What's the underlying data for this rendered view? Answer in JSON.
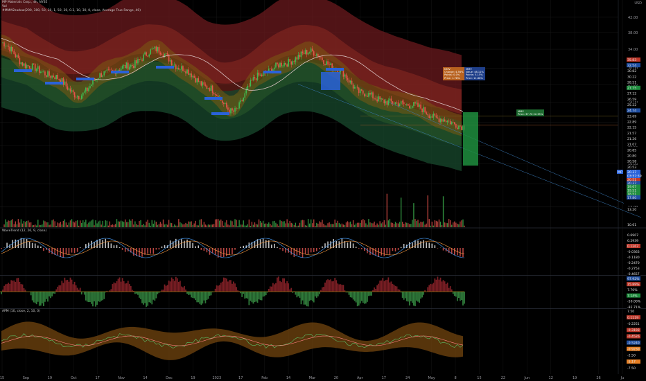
{
  "header": {
    "symbol_line": "MP Materials Corp., 4h, NYSE",
    "vol_line": "Vol",
    "indicator_line": "#MMAShadow(200, 300, 50, 30, 1, 50, 30, 0.3, 10, 30, 0, close, Average True Range, 40)",
    "currency": "USD"
  },
  "panes": {
    "pane2_title": "WaveTrend (12, 26, 9, close)",
    "pane4_title": "APM (10, close, 2, 10, 0)"
  },
  "info_boxes": {
    "orange": {
      "title": "MMV",
      "lines": [
        "Change: 4.56%",
        "Points: 0.0%",
        "Price: 1.78%"
      ]
    },
    "blue": {
      "title": "MMV",
      "lines": [
        "Value: 48.11%",
        "Points: 5.15%",
        "Price: 11.88%"
      ]
    },
    "green": {
      "title": "MMV",
      "lines": [
        "Price: 37.70 22.35%"
      ]
    }
  },
  "chart_data": {
    "type": "line",
    "symbol": "MP",
    "timeframe": "4h",
    "x_tick_labels": [
      "15",
      "Sep",
      "19",
      "Oct",
      "17",
      "Nov",
      "14",
      "Dec",
      "19",
      "2023",
      "17",
      "Feb",
      "14",
      "Mar",
      "20",
      "Apr",
      "17",
      "24",
      "May",
      "8",
      "15",
      "22",
      "Jun",
      "12",
      "19",
      "26",
      "Ju"
    ],
    "price_axis_ticks": [
      42.0,
      38.0,
      34.0,
      30.0,
      27.0,
      24.0,
      21.0,
      18.0,
      16.0,
      14.0,
      12.0
    ],
    "price_scale": "log",
    "price_labels": [
      {
        "value": "35.83",
        "color": "#c0392b"
      },
      {
        "value": "32.54",
        "color": "#1f4fa3"
      },
      {
        "value": "30.82",
        "color": "#000000"
      },
      {
        "value": "30.22",
        "color": "#000000"
      },
      {
        "value": "28.51",
        "color": "#000000"
      },
      {
        "value": "27.75",
        "color": "#1e8e3e"
      },
      {
        "value": "27.12",
        "color": "#000000"
      },
      {
        "value": "26.59",
        "color": "#000000"
      },
      {
        "value": "25.22",
        "color": "#000000"
      },
      {
        "value": "24.74",
        "color": "#1f4fa3"
      },
      {
        "value": "23.69",
        "color": "#000000"
      },
      {
        "value": "22.89",
        "color": "#000000"
      },
      {
        "value": "22.15",
        "color": "#000000"
      },
      {
        "value": "21.57",
        "color": "#000000"
      },
      {
        "value": "21.26",
        "color": "#000000"
      },
      {
        "value": "21.07",
        "color": "#000000"
      },
      {
        "value": "20.85",
        "color": "#000000"
      },
      {
        "value": "20.80",
        "color": "#000000"
      },
      {
        "value": "20.58",
        "color": "#000000"
      },
      {
        "value": "20.53",
        "color": "#000000"
      },
      {
        "value": "20.51",
        "color": "#c0392b"
      },
      {
        "value": "20.37",
        "color": "#1f4fa3"
      },
      {
        "value": "19.67",
        "color": "#1e8e3e"
      },
      {
        "value": "19.51",
        "color": "#1e8e3e"
      },
      {
        "value": "18.51",
        "color": "#1e8e3e"
      },
      {
        "value": "17.80",
        "color": "#1f4fa3"
      },
      {
        "value": "13.20",
        "color": "#000000"
      },
      {
        "value": "10.61",
        "color": "#000000"
      }
    ],
    "last_price": {
      "symbol": "MP",
      "value": "20.37",
      "countdown": "03:57:39"
    },
    "price_approx": {
      "x": [
        "15",
        "Sep",
        "19",
        "Oct",
        "17",
        "Nov",
        "14",
        "Dec",
        "19",
        "2023",
        "17",
        "Feb",
        "14",
        "Mar",
        "20",
        "Apr",
        "17",
        "24",
        "May"
      ],
      "close": [
        35.5,
        30.5,
        28.5,
        25.0,
        29.0,
        30.5,
        34.0,
        30.0,
        26.5,
        22.5,
        28.5,
        31.0,
        33.5,
        30.0,
        25.5,
        24.0,
        23.5,
        21.5,
        20.4
      ]
    },
    "pane2_labels": [
      {
        "value": "0.6907",
        "color": "#000000"
      },
      {
        "value": "0.2939",
        "color": "#000000"
      },
      {
        "value": "0.1267",
        "color": "#c0392b"
      },
      {
        "value": "-0.0363",
        "color": "#000000"
      },
      {
        "value": "-0.1180",
        "color": "#000000"
      },
      {
        "value": "-0.2470",
        "color": "#000000"
      },
      {
        "value": "-0.2753",
        "color": "#000000"
      },
      {
        "value": "-0.4657",
        "color": "#000000"
      }
    ],
    "pane3_labels": [
      {
        "value": "97.92%",
        "color": "#1f4fa3"
      },
      {
        "value": "15.89%",
        "color": "#c0392b"
      },
      {
        "value": "7.70%",
        "color": "#000000"
      },
      {
        "value": "7.14%",
        "color": "#1e8e3e"
      },
      {
        "value": "-50.00%",
        "color": "#000000"
      },
      {
        "value": "-82.71%",
        "color": "#000000"
      }
    ],
    "pane4_labels": [
      {
        "value": "7.50",
        "color": "#000000"
      },
      {
        "value": "0.1119",
        "color": "#c0392b"
      },
      {
        "value": "-0.2251",
        "color": "#000000"
      },
      {
        "value": "-0.3193",
        "color": "#c0392b"
      },
      {
        "value": "-0.4526",
        "color": "#c0392b"
      },
      {
        "value": "-0.5240",
        "color": "#1f4fa3"
      },
      {
        "value": "-0.9230",
        "color": "#e67e22"
      },
      {
        "value": "-2.50",
        "color": "#000000"
      },
      {
        "value": "-5.17",
        "color": "#e67e22"
      },
      {
        "value": "-7.50",
        "color": "#000000"
      }
    ]
  }
}
